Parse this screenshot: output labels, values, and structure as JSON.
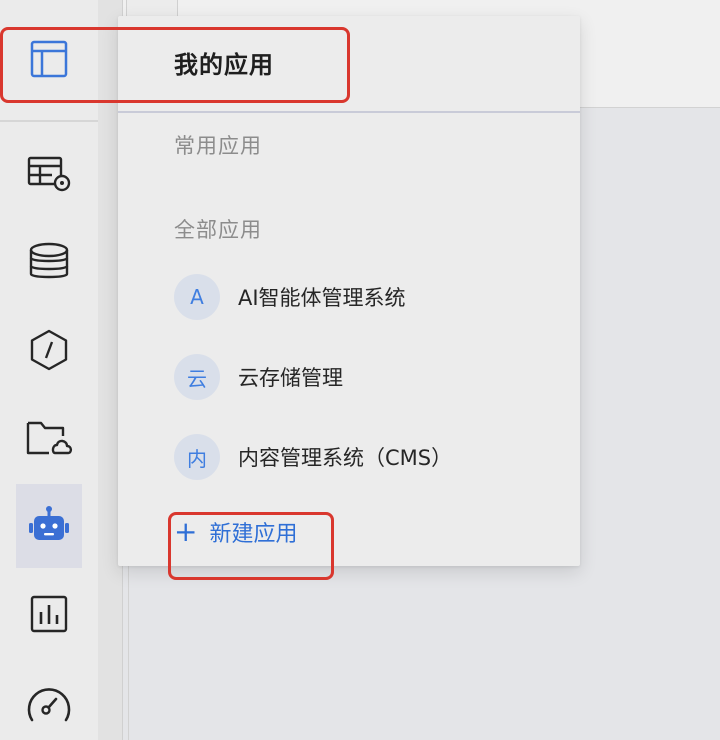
{
  "panel": {
    "title": "我的应用",
    "sections": {
      "frequent": "常用应用",
      "all": "全部应用"
    },
    "apps": [
      {
        "avatar": "A",
        "name": "AI智能体管理系统"
      },
      {
        "avatar": "云",
        "name": "云存储管理"
      },
      {
        "avatar": "内",
        "name": "内容管理系统（CMS）"
      }
    ],
    "new_app": {
      "icon": "+",
      "label": "新建应用"
    }
  },
  "rail": {
    "items": [
      {
        "icon": "layout-panel-icon",
        "active": false
      },
      {
        "icon": "table-settings-icon",
        "active": false
      },
      {
        "icon": "database-icon",
        "active": false
      },
      {
        "icon": "hexagon-slash-icon",
        "active": false
      },
      {
        "icon": "folder-cloud-icon",
        "active": false
      },
      {
        "icon": "robot-icon",
        "active": true
      },
      {
        "icon": "bar-chart-icon",
        "active": false
      },
      {
        "icon": "speedometer-icon",
        "active": false
      }
    ]
  },
  "colors": {
    "accent": "#2f6fd6",
    "avatar_bg": "#d9dfea",
    "highlight": "#d9372e",
    "robot": "#3b6fd4"
  }
}
